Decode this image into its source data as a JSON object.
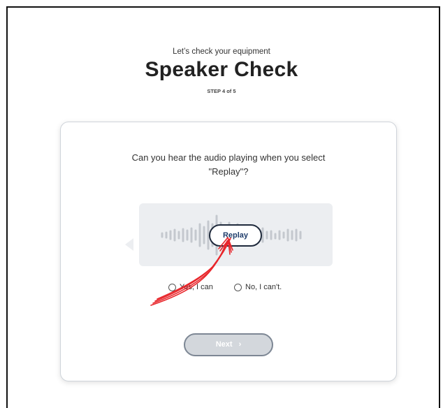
{
  "header": {
    "subtitle": "Let’s check your equipment",
    "title": "Speaker Check",
    "step": "STEP 4 of 5"
  },
  "card": {
    "question_line1": "Can you hear the audio playing when you select",
    "question_line2": "\"Replay\"?",
    "replay_label": "Replay",
    "options": [
      {
        "label": "Yes, I can",
        "selected": false
      },
      {
        "label": "No, I can't.",
        "selected": false
      }
    ],
    "next_label": "Next",
    "next_icon": "chevron-right-icon",
    "next_enabled": false
  },
  "colors": {
    "annotation_arrow": "#e8262b",
    "next_disabled_bg": "#d3d7dc",
    "replay_text": "#1f3d6b"
  }
}
